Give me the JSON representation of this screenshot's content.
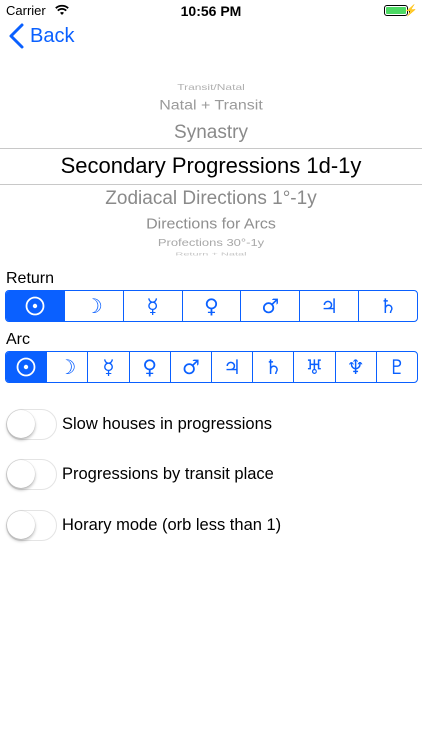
{
  "status_bar": {
    "carrier": "Carrier",
    "time": "10:56 PM",
    "battery_color": "#4cd964"
  },
  "nav": {
    "back_label": "Back"
  },
  "picker": {
    "items": [
      "Transit/Natal",
      "Natal + Transit",
      "Synastry",
      "Secondary Progressions 1d-1y",
      "Zodiacal Directions 1°-1y",
      "Directions for Arcs",
      "Profections 30°-1y",
      "Return + Natal"
    ],
    "selected": "Secondary Progressions 1d-1y"
  },
  "return_section": {
    "label": "Return",
    "selected": "sun",
    "options": [
      {
        "icon": "sun-icon",
        "glyph": "☉"
      },
      {
        "icon": "moon-icon",
        "glyph": "☽"
      },
      {
        "icon": "mercury-icon",
        "glyph": "☿"
      },
      {
        "icon": "venus-icon",
        "glyph": "♀"
      },
      {
        "icon": "mars-icon",
        "glyph": "♂"
      },
      {
        "icon": "jupiter-icon",
        "glyph": "♃"
      },
      {
        "icon": "saturn-icon",
        "glyph": "♄"
      }
    ]
  },
  "arc_section": {
    "label": "Arc",
    "selected": "sun",
    "options": [
      {
        "icon": "sun-icon",
        "glyph": "☉"
      },
      {
        "icon": "moon-icon",
        "glyph": "☽"
      },
      {
        "icon": "mercury-icon",
        "glyph": "☿"
      },
      {
        "icon": "venus-icon",
        "glyph": "♀"
      },
      {
        "icon": "mars-icon",
        "glyph": "♂"
      },
      {
        "icon": "jupiter-icon",
        "glyph": "♃"
      },
      {
        "icon": "saturn-icon",
        "glyph": "♄"
      },
      {
        "icon": "uranus-icon",
        "glyph": "♅"
      },
      {
        "icon": "neptune-icon",
        "glyph": "♆"
      },
      {
        "icon": "pluto-icon",
        "glyph": "♇"
      }
    ]
  },
  "toggles": [
    {
      "label": "Slow houses in progressions",
      "on": false
    },
    {
      "label": "Progressions by transit place",
      "on": false
    },
    {
      "label": "Horary mode (orb less than 1)",
      "on": false
    }
  ],
  "colors": {
    "accent": "#0a60ff",
    "picker_text": "#8a8a8a"
  }
}
